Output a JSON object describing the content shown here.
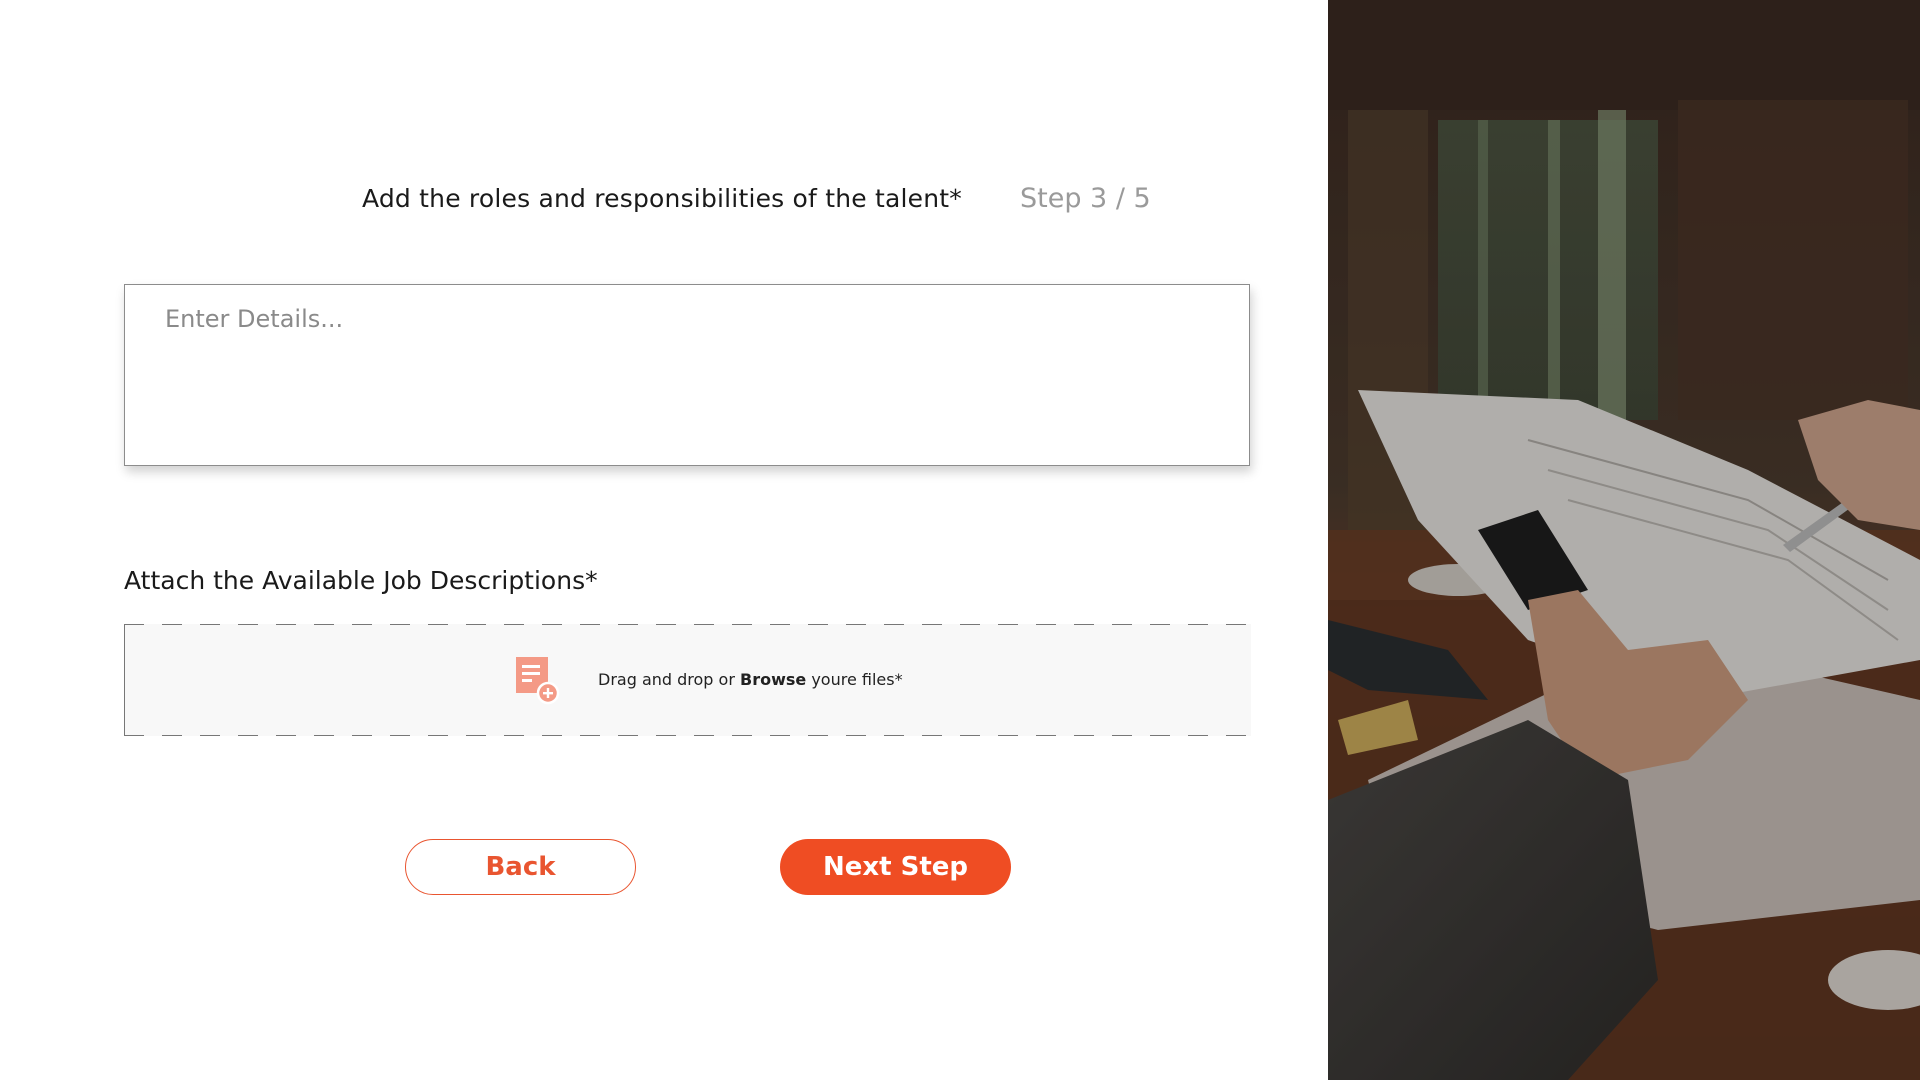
{
  "form": {
    "question": "Add the roles and responsibilities of the talent*",
    "step_label": "Step 3 / 5",
    "details_placeholder": "Enter Details...",
    "details_value": "",
    "attach_label": "Attach the Available Job Descriptions*",
    "drop_text_prefix": "Drag and drop or ",
    "drop_text_link": "Browse",
    "drop_text_suffix": " youre files*",
    "drop_icon": "file-add-icon"
  },
  "buttons": {
    "back_label": "Back",
    "next_label": "Next Step"
  },
  "colors": {
    "accent": "#ef4d23",
    "icon": "#f49a86"
  },
  "side_image": {
    "subject": "hands-exchanging-documents-photo"
  }
}
